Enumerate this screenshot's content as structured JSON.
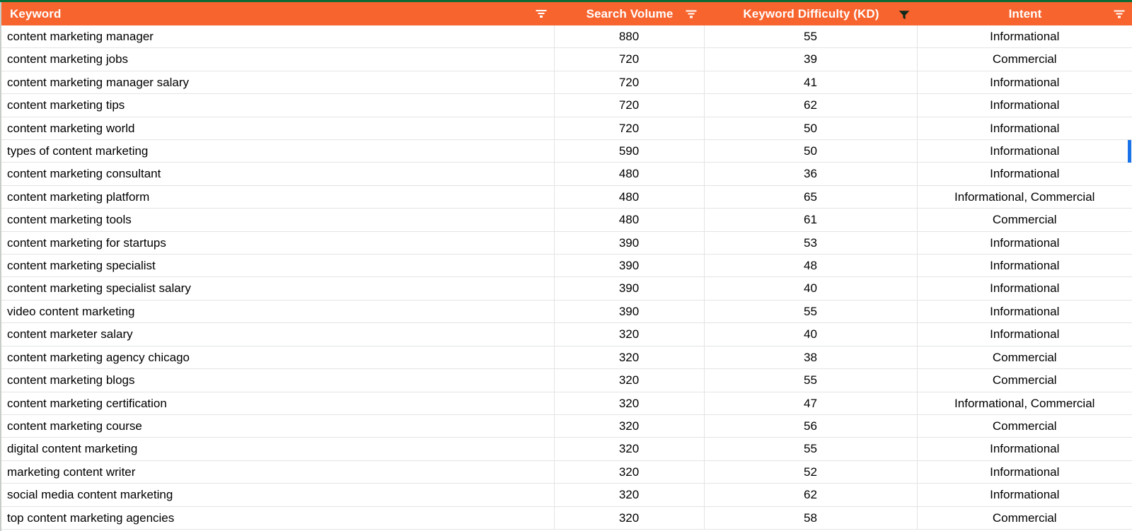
{
  "app": {
    "type": "spreadsheet-table",
    "header_bg": "#f8642e",
    "header_text_color": "#ffffff",
    "grid_line_color": "#e2e5e3",
    "top_rule_color": "#0b6b35",
    "marker_color": "#1a73e8"
  },
  "table": {
    "columns": [
      {
        "label": "Keyword",
        "align": "left",
        "filter_icon": "filter-lines-icon",
        "filter_active": false
      },
      {
        "label": "Search Volume",
        "align": "center",
        "filter_icon": "filter-lines-icon",
        "filter_active": false
      },
      {
        "label": "Keyword Difficulty (KD)",
        "align": "center",
        "filter_icon": "filter-funnel-icon",
        "filter_active": true
      },
      {
        "label": "Intent",
        "align": "center",
        "filter_icon": "filter-lines-icon",
        "filter_active": false
      }
    ],
    "rows": [
      {
        "keyword": "content marketing manager",
        "volume": "880",
        "kd": "55",
        "intent": "Informational"
      },
      {
        "keyword": "content marketing jobs",
        "volume": "720",
        "kd": "39",
        "intent": "Commercial"
      },
      {
        "keyword": "content marketing manager salary",
        "volume": "720",
        "kd": "41",
        "intent": "Informational"
      },
      {
        "keyword": "content marketing tips",
        "volume": "720",
        "kd": "62",
        "intent": "Informational"
      },
      {
        "keyword": "content marketing world",
        "volume": "720",
        "kd": "50",
        "intent": "Informational"
      },
      {
        "keyword": "types of content marketing",
        "volume": "590",
        "kd": "50",
        "intent": "Informational"
      },
      {
        "keyword": "content marketing consultant",
        "volume": "480",
        "kd": "36",
        "intent": "Informational"
      },
      {
        "keyword": "content marketing platform",
        "volume": "480",
        "kd": "65",
        "intent": "Informational, Commercial"
      },
      {
        "keyword": "content marketing tools",
        "volume": "480",
        "kd": "61",
        "intent": "Commercial"
      },
      {
        "keyword": "content marketing for startups",
        "volume": "390",
        "kd": "53",
        "intent": "Informational"
      },
      {
        "keyword": "content marketing specialist",
        "volume": "390",
        "kd": "48",
        "intent": "Informational"
      },
      {
        "keyword": "content marketing specialist salary",
        "volume": "390",
        "kd": "40",
        "intent": "Informational"
      },
      {
        "keyword": "video content marketing",
        "volume": "390",
        "kd": "55",
        "intent": "Informational"
      },
      {
        "keyword": "content marketer salary",
        "volume": "320",
        "kd": "40",
        "intent": "Informational"
      },
      {
        "keyword": "content marketing agency chicago",
        "volume": "320",
        "kd": "38",
        "intent": "Commercial"
      },
      {
        "keyword": "content marketing blogs",
        "volume": "320",
        "kd": "55",
        "intent": "Commercial"
      },
      {
        "keyword": "content marketing certification",
        "volume": "320",
        "kd": "47",
        "intent": "Informational, Commercial"
      },
      {
        "keyword": "content marketing course",
        "volume": "320",
        "kd": "56",
        "intent": "Commercial"
      },
      {
        "keyword": "digital content marketing",
        "volume": "320",
        "kd": "55",
        "intent": "Informational"
      },
      {
        "keyword": "marketing content writer",
        "volume": "320",
        "kd": "52",
        "intent": "Informational"
      },
      {
        "keyword": "social media content marketing",
        "volume": "320",
        "kd": "62",
        "intent": "Informational"
      },
      {
        "keyword": "top content marketing agencies",
        "volume": "320",
        "kd": "58",
        "intent": "Commercial"
      }
    ],
    "active_marker_row_index": 5
  }
}
